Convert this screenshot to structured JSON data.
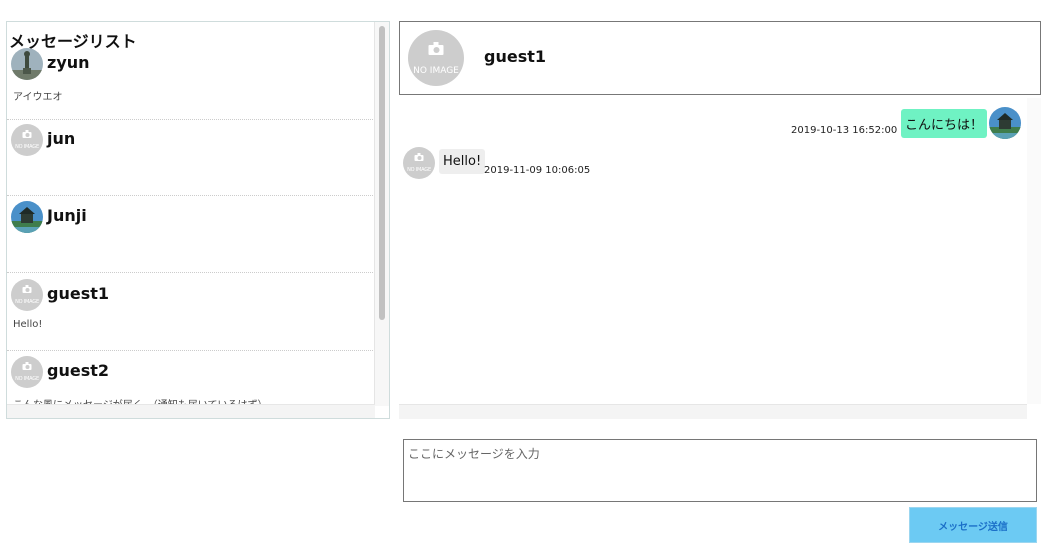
{
  "message_list": {
    "title": "メッセージリスト",
    "conversations": [
      {
        "name": "zyun",
        "preview": "アイウエオ",
        "avatar": "statue-photo-icon"
      },
      {
        "name": "jun",
        "preview": "",
        "avatar": "no-image-icon"
      },
      {
        "name": "Junji",
        "preview": "",
        "avatar": "castle-photo-icon"
      },
      {
        "name": "guest1",
        "preview": "Hello!",
        "avatar": "no-image-icon"
      },
      {
        "name": "guest2",
        "preview": "こんな風にメッセージが届く。（通知も届いているはず）...",
        "avatar": "no-image-icon"
      }
    ]
  },
  "chat": {
    "partner_name": "guest1",
    "no_image_label": "NO IMAGE",
    "messages": [
      {
        "text": "こんにちは！",
        "time": "2019-10-13 16:52:00",
        "from": "me"
      },
      {
        "text": "Hello!",
        "time": "2019-11-09 10:06:05",
        "from": "partner"
      }
    ]
  },
  "composer": {
    "placeholder": "ここにメッセージを入力",
    "send_label": "メッセージ送信"
  },
  "colors": {
    "my_bubble": "#6ff2c3",
    "partner_bubble": "#eeeeee",
    "send_button": "#6ccaf3"
  }
}
